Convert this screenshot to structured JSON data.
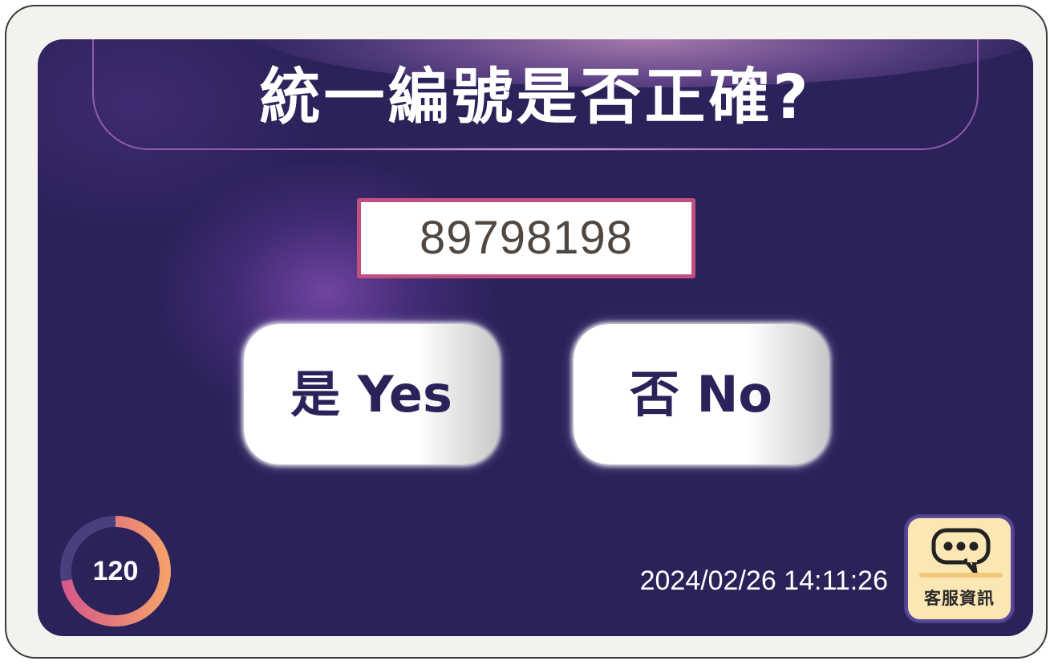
{
  "title": "統一編號是否正確?",
  "tax_id": "89798198",
  "buttons": {
    "yes_label": "是 Yes",
    "no_label": "否 No"
  },
  "countdown": {
    "seconds": "120",
    "progress_fraction": 0.72
  },
  "datetime": "2024/02/26 14:11:26",
  "service": {
    "label": "客服資訊",
    "icon": "chat-bubble-icon"
  },
  "colors": {
    "background": "#2b2259",
    "accent_pink": "#c2507f",
    "button_text": "#2b2259",
    "service_bg": "#fbe7b4"
  }
}
